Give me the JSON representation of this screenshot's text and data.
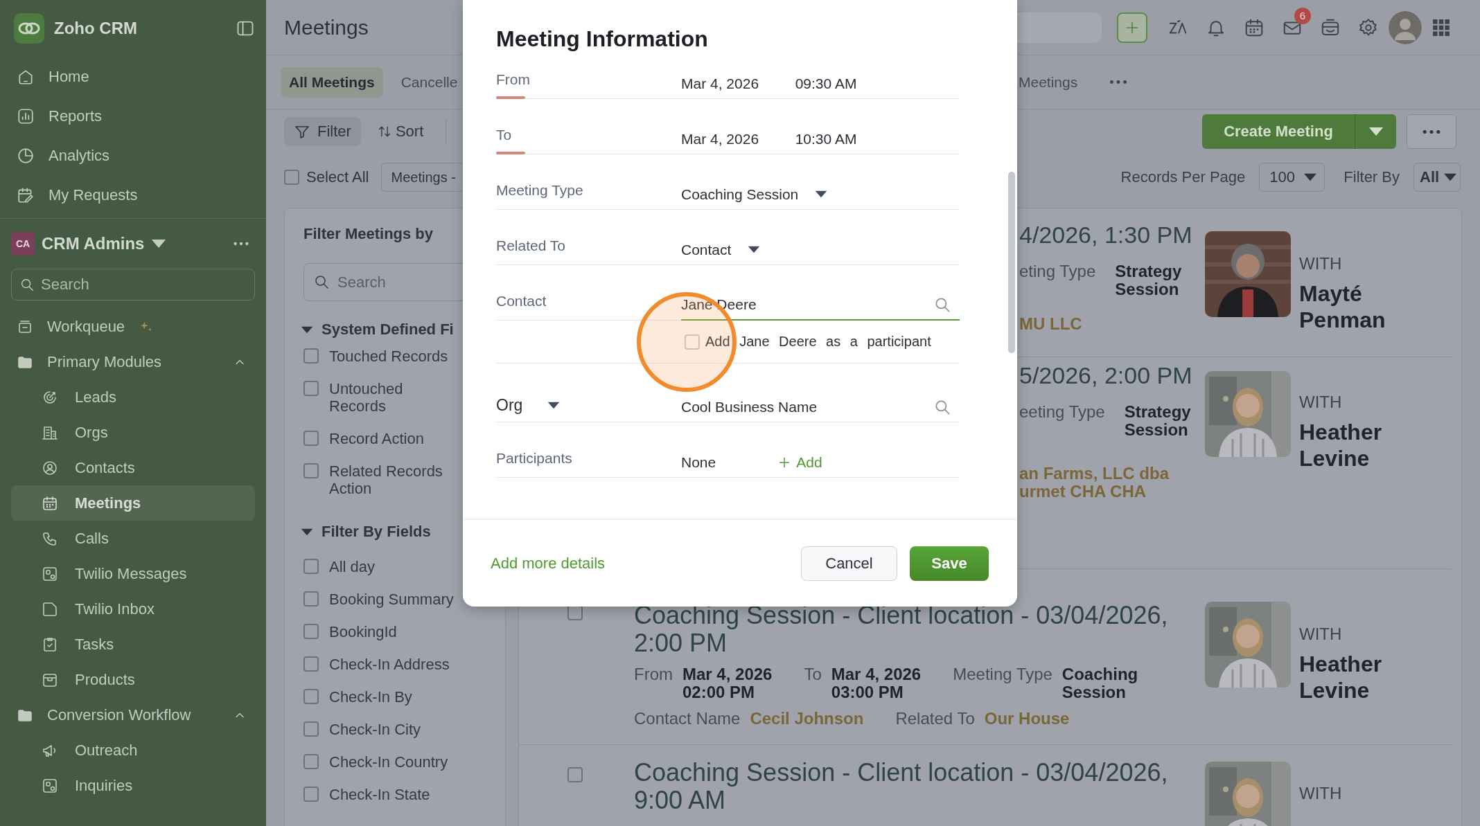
{
  "sidebar": {
    "app_name": "Zoho CRM",
    "nav": [
      {
        "label": "Home",
        "selected": false
      },
      {
        "label": "Reports",
        "selected": false
      },
      {
        "label": "Analytics",
        "selected": false
      },
      {
        "label": "My Requests",
        "selected": false
      }
    ],
    "workspace": {
      "initials": "CA",
      "name": "CRM Admins"
    },
    "search": {
      "placeholder": "Search"
    },
    "items": [
      {
        "kind": "link",
        "label": "Workqueue",
        "selected": false
      },
      {
        "kind": "group",
        "label": "Primary Modules",
        "expanded": true,
        "children": [
          {
            "label": "Leads",
            "selected": false
          },
          {
            "label": "Orgs",
            "selected": false
          },
          {
            "label": "Contacts",
            "selected": false
          },
          {
            "label": "Meetings",
            "selected": true
          },
          {
            "label": "Calls",
            "selected": false
          },
          {
            "label": "Twilio Messages",
            "selected": false
          },
          {
            "label": "Twilio Inbox",
            "selected": false
          },
          {
            "label": "Tasks",
            "selected": false
          },
          {
            "label": "Products",
            "selected": false
          }
        ]
      },
      {
        "kind": "group",
        "label": "Conversion Workflow",
        "expanded": true,
        "children": [
          {
            "label": "Outreach",
            "selected": false
          },
          {
            "label": "Inquiries",
            "selected": false
          }
        ]
      }
    ]
  },
  "header": {
    "title": "Meetings",
    "notification_count": "6"
  },
  "tabs": [
    {
      "label": "All Meetings",
      "selected": true
    },
    {
      "label": "Cancelle",
      "selected": false
    },
    {
      "label": "Meetings",
      "selected": false
    }
  ],
  "toolbar": {
    "filter": "Filter",
    "sort": "Sort",
    "create": "Create Meeting"
  },
  "list_controls": {
    "select_all": {
      "label": "Select All",
      "checked": false
    },
    "view": "Meetings -",
    "records_per_page_label": "Records Per Page",
    "records_per_page": "100",
    "filter_by_label": "Filter By",
    "filter_by": "All"
  },
  "filter_panel": {
    "title": "Filter Meetings by",
    "search_placeholder": "Search",
    "sections": [
      {
        "title": "System Defined Fi",
        "expanded": true,
        "options": [
          {
            "label": "Touched Records",
            "checked": false
          },
          {
            "label": "Untouched\nRecords",
            "checked": false
          },
          {
            "label": "Record Action",
            "checked": false
          },
          {
            "label": "Related Records\nAction",
            "checked": false
          }
        ]
      },
      {
        "title": "Filter By Fields",
        "expanded": true,
        "options": [
          {
            "label": "All day",
            "checked": false
          },
          {
            "label": "Booking Summary",
            "checked": false
          },
          {
            "label": "BookingId",
            "checked": false
          },
          {
            "label": "Check-In Address",
            "checked": false
          },
          {
            "label": "Check-In By",
            "checked": false
          },
          {
            "label": "Check-In City",
            "checked": false
          },
          {
            "label": "Check-In Country",
            "checked": false
          },
          {
            "label": "Check-In State",
            "checked": false
          }
        ]
      }
    ]
  },
  "records": [
    {
      "kind": "partial",
      "title": "4/2026, 1:30 PM",
      "fields": [
        {
          "label": "eting Type",
          "value": "Strategy\nSession"
        }
      ],
      "links": [
        {
          "value": "MU LLC"
        }
      ],
      "with_label": "WITH",
      "name": "Mayté Penman",
      "photo": {
        "kind": "picture"
      }
    },
    {
      "kind": "partial",
      "title": "5/2026, 2:00 PM",
      "fields": [
        {
          "label": "eeting Type",
          "value": "Strategy\nSession"
        }
      ],
      "links": [
        {
          "value": "an Farms, LLC dba\nurmet CHA CHA"
        }
      ],
      "with_label": "WITH",
      "name": "Heather Levine",
      "photo": {
        "kind": "picture"
      }
    },
    {
      "kind": "full",
      "checked": false,
      "title": "Coaching Session - Client location - 03/04/2026, 2:00 PM",
      "fields": [
        {
          "label": "From",
          "value": "Mar 4, 2026\n02:00 PM"
        },
        {
          "label": "To",
          "value": "Mar 4, 2026\n03:00 PM"
        },
        {
          "label": "Meeting Type",
          "value": "Coaching\nSession"
        }
      ],
      "links": [
        {
          "label": "Contact Name",
          "value": "Cecil Johnson"
        },
        {
          "label": "Related To",
          "value": "Our House"
        }
      ],
      "with_label": "WITH",
      "name": "Heather Levine",
      "photo": {
        "kind": "picture"
      }
    },
    {
      "kind": "full",
      "checked": false,
      "title": "Coaching Session - Client location - 03/04/2026, 9:00 AM",
      "with_label": "WITH",
      "photo": {
        "kind": "picture"
      }
    }
  ],
  "modal": {
    "title": "Meeting Information",
    "rows": [
      {
        "kind": "datetime",
        "label": "From",
        "date": "Mar 4, 2026",
        "time": "09:30 AM"
      },
      {
        "kind": "datetime",
        "label": "To",
        "date": "Mar 4, 2026",
        "time": "10:30 AM"
      },
      {
        "kind": "select",
        "label": "Meeting Type",
        "value": "Coaching Session"
      },
      {
        "kind": "select",
        "label": "Related To",
        "value": "Contact"
      },
      {
        "kind": "lookup",
        "label": "Contact",
        "value": "Jane Deere",
        "focused": true
      },
      {
        "kind": "checkbox",
        "label": "Add Jane Deere as a participant",
        "checked": false
      },
      {
        "kind": "lookup_select",
        "label": "Org",
        "value": "Cool Business Name",
        "focused": false
      },
      {
        "kind": "participants",
        "label": "Participants",
        "value": "None",
        "action": "Add"
      }
    ],
    "more_link": "Add more details",
    "buttons": [
      {
        "label": "Cancel",
        "kind": "secondary"
      },
      {
        "label": "Save",
        "kind": "primary"
      }
    ]
  }
}
